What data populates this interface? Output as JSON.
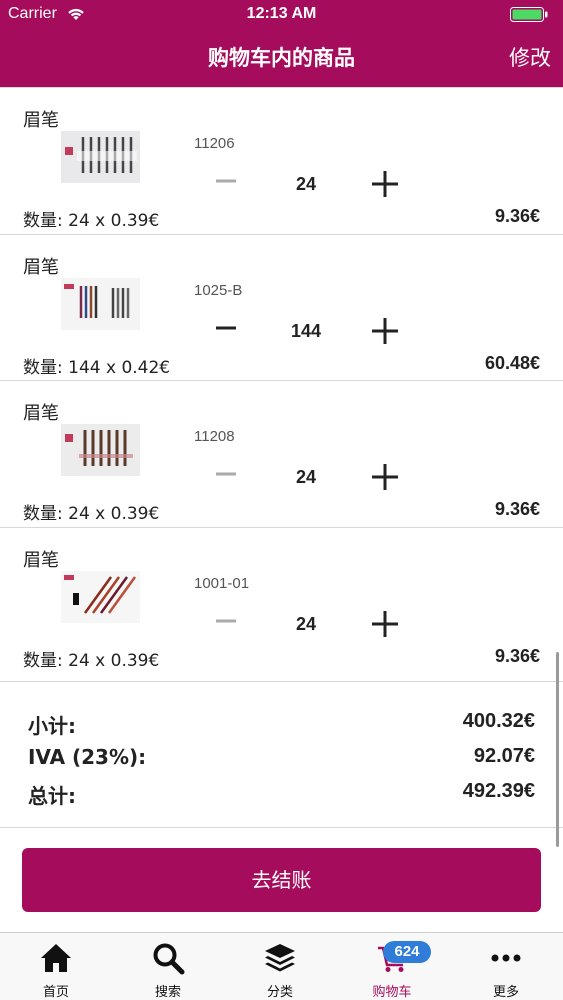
{
  "status_bar": {
    "carrier": "Carrier",
    "time": "12:13 AM"
  },
  "header": {
    "title": "购物车内的商品",
    "edit_label": "修改"
  },
  "items": [
    {
      "name": "眉笔",
      "code": "11206",
      "quantity": "24",
      "qty_line": "数量: 24 x 0.39€",
      "total": "9.36€",
      "thumb": "brow-pencil-set-1"
    },
    {
      "name": "眉笔",
      "code": "1025-B",
      "quantity": "144",
      "qty_line": "数量: 144 x 0.42€",
      "total": "60.48€",
      "thumb": "brow-pencil-set-2"
    },
    {
      "name": "眉笔",
      "code": "11208",
      "quantity": "24",
      "qty_line": "数量: 24 x 0.39€",
      "total": "9.36€",
      "thumb": "brow-pencil-set-3"
    },
    {
      "name": "眉笔",
      "code": "1001-01",
      "quantity": "24",
      "qty_line": "数量: 24 x 0.39€",
      "total": "9.36€",
      "thumb": "brow-pencil-set-4"
    }
  ],
  "summary": {
    "subtotal_label": "小计:",
    "subtotal_value": "400.32€",
    "vat_label": "IVA (23%):",
    "vat_value": "92.07€",
    "total_label": "总计:",
    "total_value": "492.39€"
  },
  "checkout_label": "去结账",
  "tabs": [
    {
      "label": "首页",
      "icon": "home-icon"
    },
    {
      "label": "搜索",
      "icon": "search-icon"
    },
    {
      "label": "分类",
      "icon": "layers-icon"
    },
    {
      "label": "购物车",
      "icon": "cart-icon",
      "active": true
    },
    {
      "label": "更多",
      "icon": "more-icon"
    }
  ],
  "cart_badge": "624",
  "colors": {
    "brand": "#a60c5c",
    "badge": "#2f7dd8",
    "minus_disabled": "#aaaaaa",
    "minus_enabled": "#222222"
  }
}
